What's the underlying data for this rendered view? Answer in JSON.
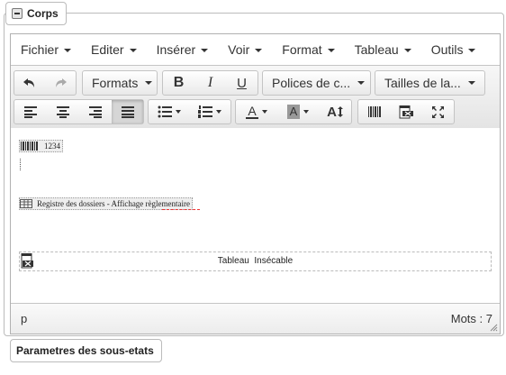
{
  "panel": {
    "title": "Corps"
  },
  "menubar": {
    "items": [
      "Fichier",
      "Editer",
      "Insérer",
      "Voir",
      "Format",
      "Tableau",
      "Outils"
    ]
  },
  "toolbar": {
    "formats_label": "Formats",
    "fonts_label": "Polices de c...",
    "sizes_label": "Tailles de la...",
    "bold": "B",
    "italic": "I",
    "underline": "U",
    "text_color_label": "A",
    "bg_color_label": "A",
    "case_label": "A"
  },
  "content": {
    "barcode_text": "1234",
    "register_text": "Registre des dossiers - Affichage règlementaire",
    "table_text": "Tableau  Insécable"
  },
  "statusbar": {
    "path": "p",
    "wordcount": "Mots : 7"
  },
  "subpanel": {
    "title": "Parametres des sous-etats"
  },
  "colors": {
    "border": "#b1b1b1",
    "toolbar_bg": "#e8e8e8",
    "active_btn": "#d6d6d6"
  }
}
